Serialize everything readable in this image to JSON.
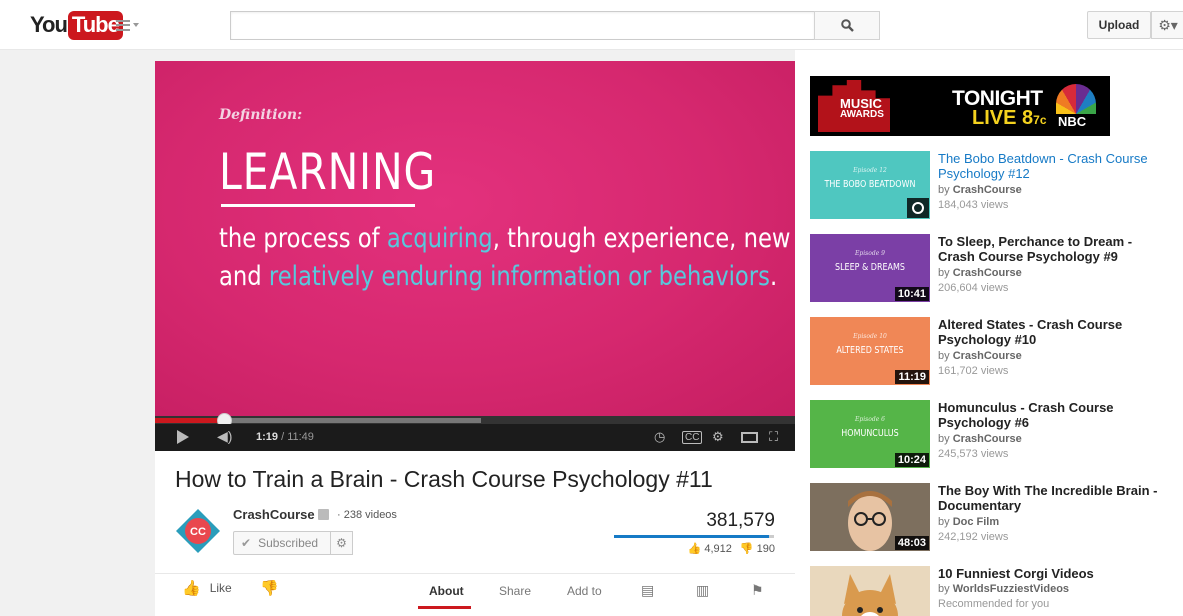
{
  "header": {
    "logo_you": "You",
    "logo_tube": "Tube",
    "search_placeholder": "",
    "upload_label": "Upload"
  },
  "player": {
    "slide": {
      "definition_label": "Definition:",
      "heading": "LEARNING",
      "line1_a": "the process of ",
      "line1_hl": "acquiring",
      "line1_b": ", through experience, new",
      "line2_a": "and ",
      "line2_hl": "relatively enduring information or behaviors",
      "line2_b": "."
    },
    "current_time": "1:19",
    "duration": "/ 11:49",
    "played_fraction": 0.11,
    "buffered_fraction": 0.51
  },
  "video": {
    "title": "How to Train a Brain - Crash Course Psychology #11",
    "channel": "CrashCourse",
    "video_count": "· 238 videos",
    "subscribe_label": "Subscribed",
    "views": "381,579",
    "likes": "4,912",
    "dislikes": "190",
    "like_label": "Like",
    "tabs": [
      "About",
      "Share",
      "Add to"
    ]
  },
  "ad": {
    "music": "MUSIC",
    "awards": "AWARDS",
    "tonight": "TONIGHT",
    "live": "LIVE 8",
    "live_sup": "7c",
    "nbc": "NBC"
  },
  "recommendations": [
    {
      "title": "The Bobo Beatdown - Crash Course Psychology #12",
      "by": "by",
      "channel": "CrashCourse",
      "views": "184,043 views",
      "duration": "",
      "thumb_text": "THE BOBO BEATDOWN",
      "thumb_ep": "Episode 12",
      "thumb_color": "#4fc7c0"
    },
    {
      "title": "To Sleep, Perchance to Dream - Crash Course Psychology #9",
      "by": "by",
      "channel": "CrashCourse",
      "views": "206,604 views",
      "duration": "10:41",
      "thumb_text": "SLEEP & DREAMS",
      "thumb_ep": "Episode 9",
      "thumb_color": "#7b3fa6"
    },
    {
      "title": "Altered States - Crash Course Psychology #10",
      "by": "by",
      "channel": "CrashCourse",
      "views": "161,702 views",
      "duration": "11:19",
      "thumb_text": "ALTERED STATES",
      "thumb_ep": "Episode 10",
      "thumb_color": "#f08756"
    },
    {
      "title": "Homunculus - Crash Course Psychology #6",
      "by": "by",
      "channel": "CrashCourse",
      "views": "245,573 views",
      "duration": "10:24",
      "thumb_text": "HOMUNCULUS",
      "thumb_ep": "Episode 6",
      "thumb_color": "#55b548"
    },
    {
      "title": "The Boy With The Incredible Brain - Documentary",
      "by": "by",
      "channel": "Doc Film",
      "views": "242,192 views",
      "duration": "48:03",
      "thumb_text": "",
      "thumb_ep": "",
      "thumb_color": "#8a7a66"
    },
    {
      "title": "10 Funniest Corgi Videos",
      "by": "by",
      "channel": "WorldsFuzziestVideos",
      "views": "Recommended for you",
      "duration": "",
      "thumb_text": "",
      "thumb_ep": "",
      "thumb_color": "#d9b27a"
    }
  ]
}
